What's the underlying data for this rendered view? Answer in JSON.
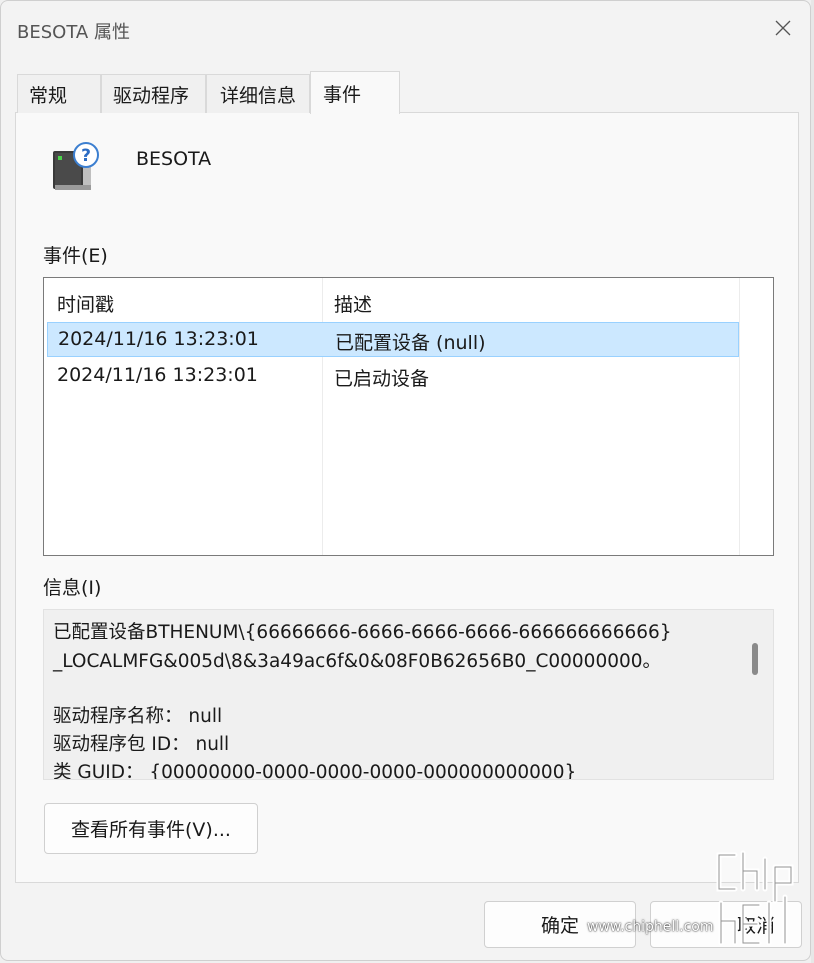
{
  "window": {
    "title": "BESOTA 属性"
  },
  "tabs": [
    {
      "label": "常规"
    },
    {
      "label": "驱动程序"
    },
    {
      "label": "详细信息"
    },
    {
      "label": "事件"
    }
  ],
  "device": {
    "name": "BESOTA"
  },
  "events": {
    "label": "事件(E)",
    "columns": [
      "时间戳",
      "描述"
    ],
    "rows": [
      {
        "timestamp": "2024/11/16 13:23:01",
        "description": "已配置设备 (null)",
        "selected": true
      },
      {
        "timestamp": "2024/11/16 13:23:01",
        "description": "已启动设备",
        "selected": false
      }
    ]
  },
  "info": {
    "label": "信息(I)",
    "lines": [
      "已配置设备BTHENUM\\{66666666-6666-6666-6666-666666666666}",
      "_LOCALMFG&005d\\8&3a49ac6f&0&08F0B62656B0_C00000000。",
      "",
      "驱动程序名称： null",
      "驱动程序包 ID： null",
      "类 GUID： {00000000-0000-0000-0000-000000000000}"
    ]
  },
  "buttons": {
    "view_all": "查看所有事件(V)...",
    "ok": "确定",
    "cancel": "取消"
  },
  "watermark": {
    "text": "www.chiphell.com"
  },
  "colors": {
    "selection": "#cce8ff",
    "selection_border": "#99d1ff"
  }
}
